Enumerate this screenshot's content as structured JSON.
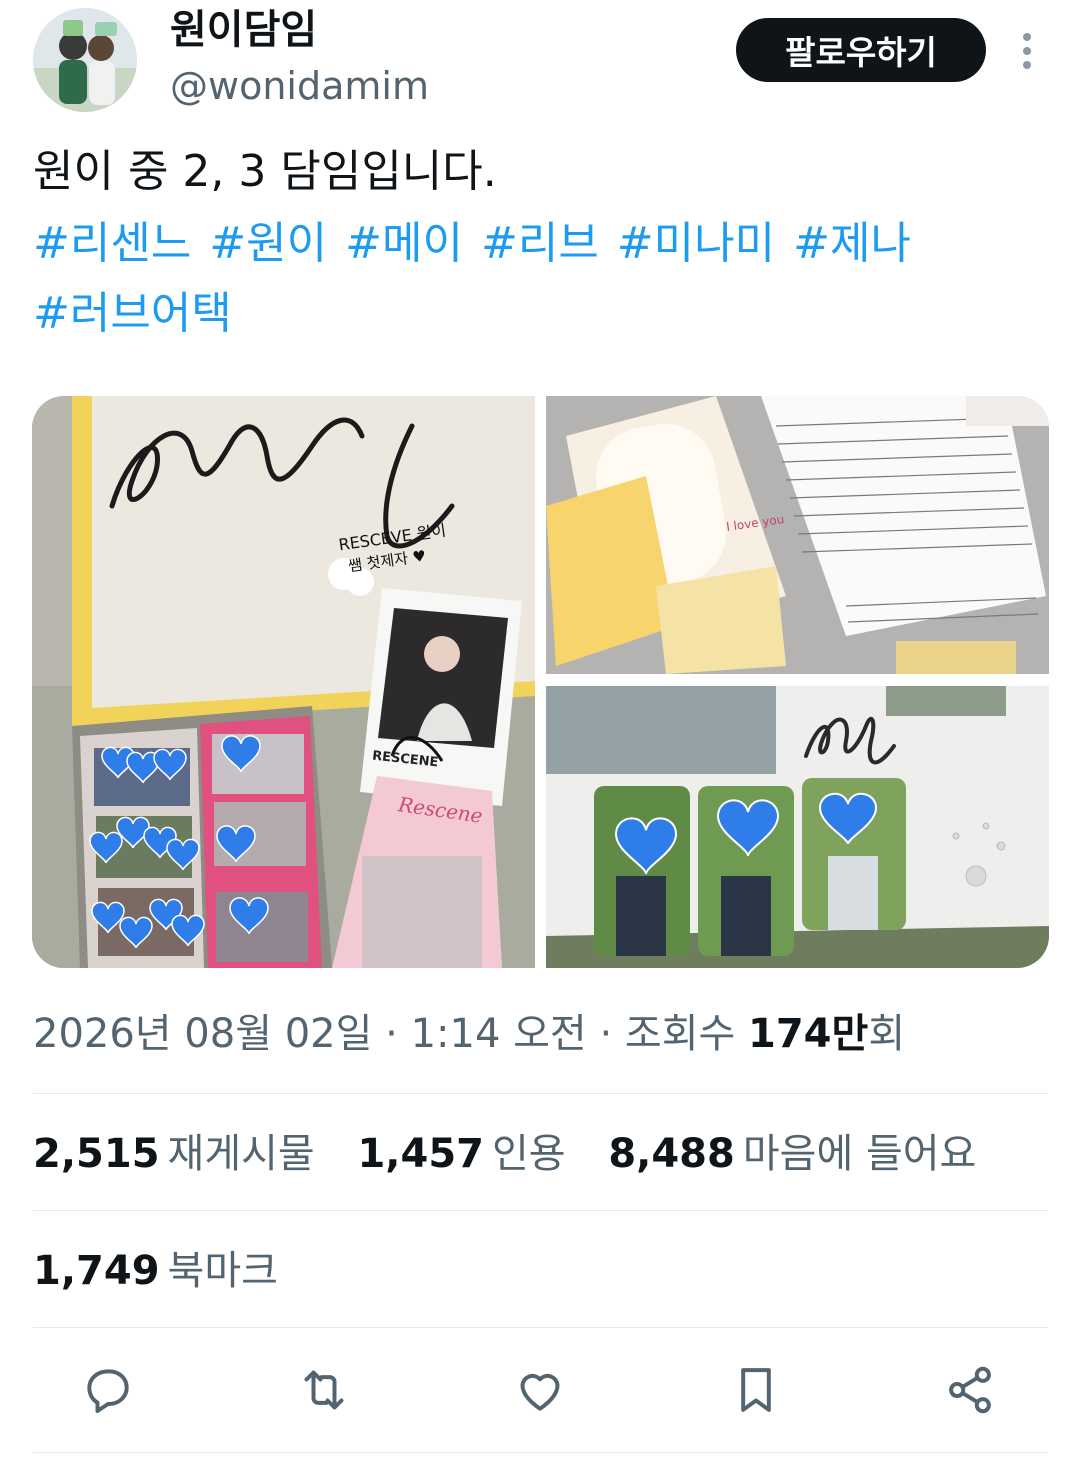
{
  "author": {
    "display_name": "원이담임",
    "handle": "@wonidamim"
  },
  "follow_label": "팔로우하기",
  "tweet_text": "원이 중 2, 3 담임입니다.",
  "hashtags_line1": [
    "#리센느",
    "#원이",
    "#메이",
    "#리브",
    "#미나미",
    "#제나"
  ],
  "hashtags_line2": [
    "#러브어택"
  ],
  "meta": {
    "date": "2026년 08월 02일",
    "time": "1:14 오전",
    "views_label": "조회수",
    "views_number": "174만",
    "views_suffix": "회",
    "separator": "·"
  },
  "stats": {
    "reposts_count": "2,515",
    "reposts_label": "재게시물",
    "quotes_count": "1,457",
    "quotes_label": "인용",
    "likes_count": "8,488",
    "likes_label": "마음에 들어요",
    "bookmarks_count": "1,749",
    "bookmarks_label": "북마크"
  },
  "media_text": {
    "sign_caption_1": "RESCEVE 원이",
    "sign_caption_2": "쌤 첫제자 ♥",
    "card_brand": "Rescene",
    "photocard_name": "RESCENE",
    "letter_text": "I love you"
  },
  "icons": [
    "reply-icon",
    "repost-icon",
    "like-icon",
    "bookmark-icon",
    "share-icon",
    "more-icon"
  ],
  "colors": {
    "link": "#1d9bf0",
    "secondary": "#536471",
    "heart_blue": "#2f7de8"
  }
}
